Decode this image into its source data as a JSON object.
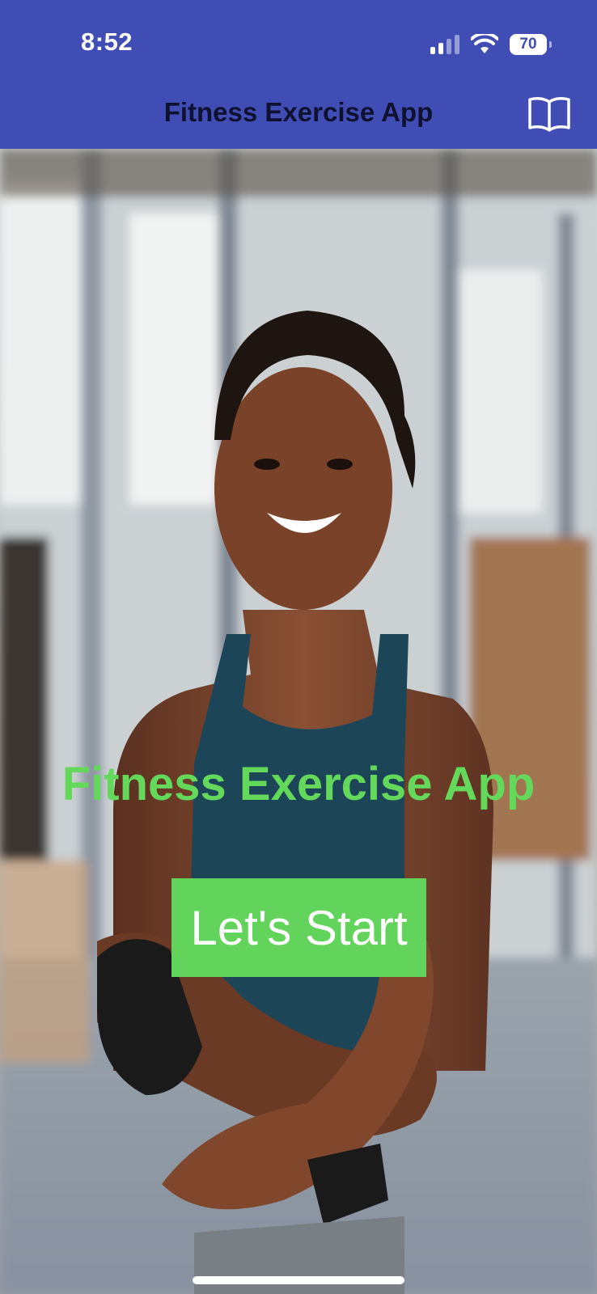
{
  "status_bar": {
    "time": "8:52",
    "battery_percent": "70",
    "signal_bars": 2,
    "icons": [
      "signal-icon",
      "wifi-icon",
      "battery-icon"
    ]
  },
  "header": {
    "title": "Fitness Exercise App",
    "icon": "book-icon"
  },
  "hero": {
    "image_description_icon": "photo-woman-gym",
    "title": "Fitness Exercise App",
    "button_label": "Let's Start"
  },
  "colors": {
    "header_bg": "#3f4db5",
    "accent_green": "#62d35b",
    "header_text": "#0e1230"
  }
}
